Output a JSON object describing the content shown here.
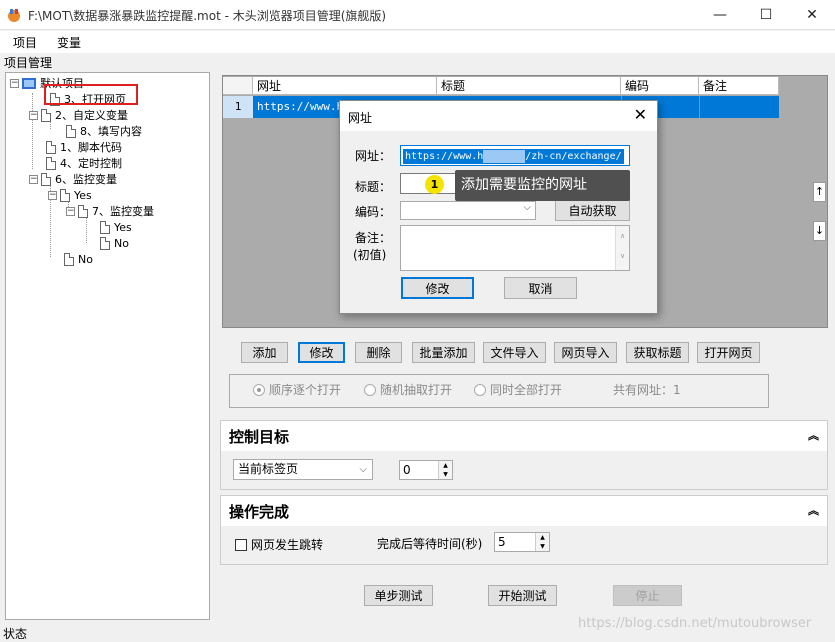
{
  "window": {
    "title": "F:\\MOT\\数据暴涨暴跌监控提醒.mot  -  木头浏览器项目管理(旗舰版)",
    "minimize_glyph": "—",
    "maximize_glyph": "☐",
    "close_glyph": "✕"
  },
  "menu": {
    "items": [
      "项目",
      "变量"
    ]
  },
  "project_panel": {
    "label": "项目管理",
    "root": "默认项目",
    "nodes": [
      "3、打开网页",
      "2、自定义变量",
      "8、填写内容",
      "1、脚本代码",
      "4、定时控制",
      "6、监控变量",
      "Yes",
      "7、监控变量",
      "Yes",
      "No",
      "No"
    ]
  },
  "grid": {
    "columns": [
      "网址",
      "标题",
      "编码",
      "备注"
    ],
    "rows": [
      {
        "index": "1",
        "url": "https://www.hu"
      }
    ]
  },
  "url_buttons": [
    "添加",
    "修改",
    "删除",
    "批量添加",
    "文件导入",
    "网页导入",
    "获取标题",
    "打开网页"
  ],
  "open_mode": {
    "options": [
      "顺序逐个打开",
      "随机抽取打开",
      "同时全部打开"
    ],
    "selected": "顺序逐个打开",
    "count_label": "共有网址：1"
  },
  "control_target": {
    "title": "控制目标",
    "select_value": "当前标签页",
    "spin_value": "0"
  },
  "operation_done": {
    "title": "操作完成",
    "checkbox_label": "网页发生跳转",
    "wait_label": "完成后等待时间(秒)",
    "wait_value": "5"
  },
  "bottom_buttons": {
    "step": "单步测试",
    "start": "开始测试",
    "stop": "停止"
  },
  "dialog": {
    "title": "网址",
    "url_label": "网址：",
    "url_value_start": "https://www.h",
    "url_value_end": "/zh-cn/exchange/",
    "title_label": "标题：",
    "encoding_label": "编码：",
    "auto_button": "自动获取",
    "note_label": "备注：",
    "note_sublabel": "(初值)",
    "ok_button": "修改",
    "cancel_button": "取消"
  },
  "tooltip": {
    "number": "1",
    "text": "添加需要监控的网址"
  },
  "side_arrows": {
    "up": "↑",
    "down": "↓"
  },
  "status": "状态",
  "watermark": "https://blog.csdn.net/mutoubrowser"
}
